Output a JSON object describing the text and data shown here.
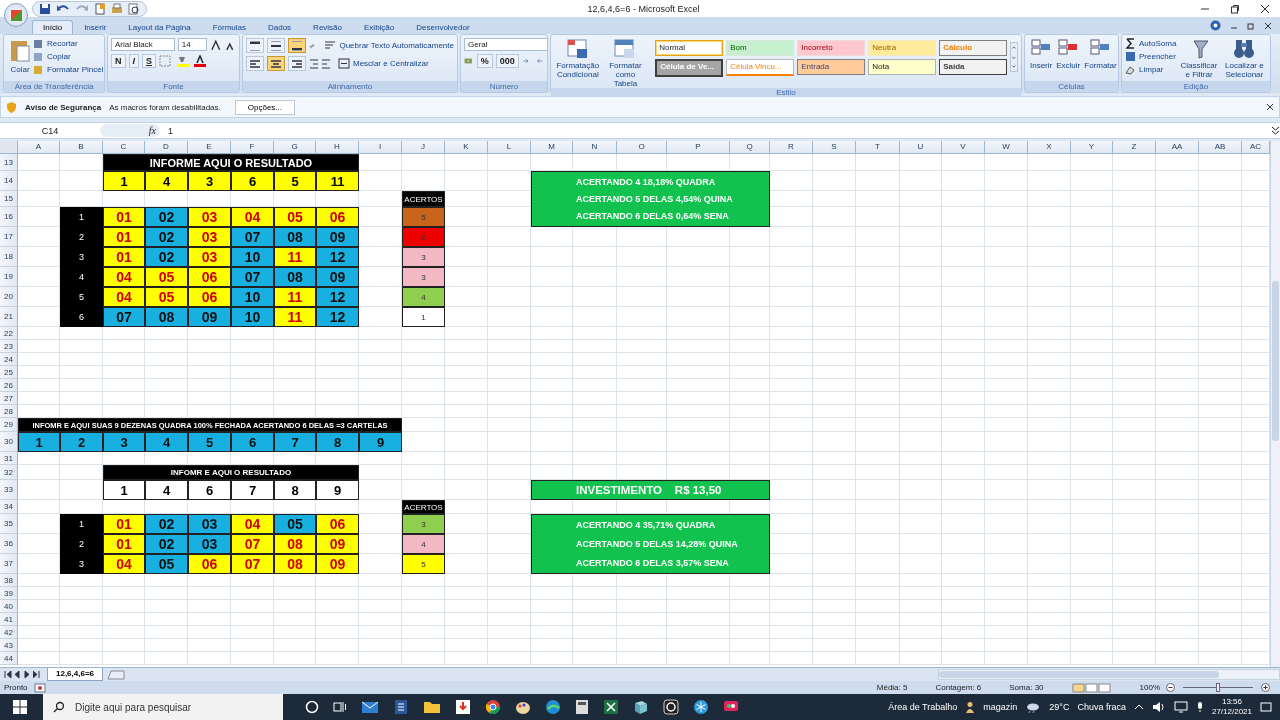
{
  "window": {
    "title": "12,6,4,6=6 - Microsoft Excel"
  },
  "tabs": [
    {
      "label": "Início",
      "selected": true
    },
    {
      "label": "Inserir",
      "selected": false
    },
    {
      "label": "Layout da Página",
      "selected": false
    },
    {
      "label": "Fórmulas",
      "selected": false
    },
    {
      "label": "Dados",
      "selected": false
    },
    {
      "label": "Revisão",
      "selected": false
    },
    {
      "label": "Exibição",
      "selected": false
    },
    {
      "label": "Desenvolvedor",
      "selected": false
    }
  ],
  "ribbon": {
    "clipboard": {
      "label": "Área de Transferência",
      "paste": "Colar",
      "items": [
        "Recortar",
        "Copiar",
        "Formatar Pincel"
      ]
    },
    "font": {
      "label": "Fonte",
      "family": "Arial Black",
      "size": "14",
      "format_buttons": [
        "N",
        "I",
        "S"
      ]
    },
    "alignment": {
      "label": "Alinhamento",
      "wrap": "Quebrar Texto Automaticamente",
      "merge": "Mesclar e Centralizar",
      "vertical": [
        {
          "selected": false
        },
        {
          "selected": false
        },
        {
          "selected": true
        }
      ],
      "horizontal": [
        {
          "selected": false
        },
        {
          "selected": true
        },
        {
          "selected": false
        }
      ]
    },
    "number": {
      "label": "Número",
      "format": "Geral",
      "buttons": [
        "%",
        "000"
      ]
    },
    "styles": {
      "label": "Estilo",
      "buttons": [
        "Formatação Condicional",
        "Formatar como Tabela"
      ],
      "gallery": [
        {
          "label": "Normal",
          "kind": "normal",
          "selected": true
        },
        {
          "label": "Bom",
          "kind": "good",
          "selected": false
        },
        {
          "label": "Incorreto",
          "kind": "bad",
          "selected": false
        },
        {
          "label": "Neutra",
          "kind": "neutral",
          "selected": false
        },
        {
          "label": "Cálculo",
          "kind": "calculation",
          "selected": false
        },
        {
          "label": "Célula de Ve...",
          "kind": "check",
          "selected": false
        },
        {
          "label": "Célula Vincu...",
          "kind": "linked",
          "selected": false
        },
        {
          "label": "Entrada",
          "kind": "input",
          "selected": false
        },
        {
          "label": "Nota",
          "kind": "note",
          "selected": false
        },
        {
          "label": "Saída",
          "kind": "output",
          "selected": false
        }
      ]
    },
    "cells": {
      "label": "Células",
      "buttons": [
        "Inserir",
        "Excluir",
        "Formatar"
      ]
    },
    "editing": {
      "label": "Edição",
      "items": [
        "AutoSoma",
        "Preencher",
        "Limpar"
      ],
      "buttons": [
        "Classificar e Filtrar",
        "Localizar e Selecionar"
      ]
    }
  },
  "security_bar": {
    "title": "Aviso de Segurança",
    "message": "As macros foram desabilitadas.",
    "button": "Opções..."
  },
  "formula_bar": {
    "name_box": "C14",
    "fx": "fx",
    "value": "1"
  },
  "sheet": {
    "columns": [
      "A",
      "B",
      "C",
      "D",
      "E",
      "F",
      "G",
      "H",
      "I",
      "J",
      "K",
      "L",
      "M",
      "N",
      "O",
      "P",
      "Q",
      "R",
      "S",
      "T",
      "U",
      "V",
      "W",
      "X",
      "Y",
      "Z",
      "AA",
      "AB",
      "AC"
    ],
    "rows": [
      "13",
      "14",
      "15",
      "16",
      "17",
      "18",
      "19",
      "20",
      "21",
      "22",
      "23",
      "24",
      "25",
      "26",
      "27",
      "28",
      "29",
      "30",
      "31",
      "32",
      "33",
      "34",
      "35",
      "36",
      "37",
      "38",
      "39",
      "40",
      "41",
      "42",
      "43",
      "44"
    ],
    "games": [
      {
        "title": "INFORME AQUI O RESULTADO",
        "result": {
          "color": "#ffff00",
          "numbers": [
            "1",
            "4",
            "3",
            "6",
            "5",
            "11"
          ]
        },
        "hits_label": "ACERTOS",
        "cards": [
          {
            "label": "1",
            "numbers": [
              {
                "text": "01",
                "hit": true
              },
              {
                "text": "02",
                "hit": false
              },
              {
                "text": "03",
                "hit": true
              },
              {
                "text": "04",
                "hit": true
              },
              {
                "text": "05",
                "hit": true
              },
              {
                "text": "06",
                "hit": true
              }
            ],
            "hits": {
              "text": "5",
              "color": "#c8651b"
            }
          },
          {
            "label": "2",
            "numbers": [
              {
                "text": "01",
                "hit": true
              },
              {
                "text": "02",
                "hit": false
              },
              {
                "text": "03",
                "hit": true
              },
              {
                "text": "07",
                "hit": false
              },
              {
                "text": "08",
                "hit": false
              },
              {
                "text": "09",
                "hit": false
              }
            ],
            "hits": {
              "text": "2",
              "color": "#ee0000"
            }
          },
          {
            "label": "3",
            "numbers": [
              {
                "text": "01",
                "hit": true
              },
              {
                "text": "02",
                "hit": false
              },
              {
                "text": "03",
                "hit": true
              },
              {
                "text": "10",
                "hit": false
              },
              {
                "text": "11",
                "hit": true
              },
              {
                "text": "12",
                "hit": false
              }
            ],
            "hits": {
              "text": "3",
              "color": "#f4b8c4"
            }
          },
          {
            "label": "4",
            "numbers": [
              {
                "text": "04",
                "hit": true
              },
              {
                "text": "05",
                "hit": true
              },
              {
                "text": "06",
                "hit": true
              },
              {
                "text": "07",
                "hit": false
              },
              {
                "text": "08",
                "hit": false
              },
              {
                "text": "09",
                "hit": false
              }
            ],
            "hits": {
              "text": "3",
              "color": "#f4b8c4"
            }
          },
          {
            "label": "5",
            "numbers": [
              {
                "text": "04",
                "hit": true
              },
              {
                "text": "05",
                "hit": true
              },
              {
                "text": "06",
                "hit": true
              },
              {
                "text": "10",
                "hit": false
              },
              {
                "text": "11",
                "hit": true
              },
              {
                "text": "12",
                "hit": false
              }
            ],
            "hits": {
              "text": "4",
              "color": "#8fce4f"
            }
          },
          {
            "label": "6",
            "numbers": [
              {
                "text": "07",
                "hit": false
              },
              {
                "text": "08",
                "hit": false
              },
              {
                "text": "09",
                "hit": false
              },
              {
                "text": "10",
                "hit": false
              },
              {
                "text": "11",
                "hit": true
              },
              {
                "text": "12",
                "hit": false
              }
            ],
            "hits": {
              "text": "1",
              "color": "#ffffff"
            }
          }
        ]
      },
      {
        "title": "INFOMR E AQUI O RESULTADO",
        "result": {
          "color": "#ffffff",
          "numbers": [
            "1",
            "4",
            "6",
            "7",
            "8",
            "9"
          ]
        },
        "hits_label": "ACERTOS",
        "cards": [
          {
            "label": "1",
            "numbers": [
              {
                "text": "01",
                "hit": true
              },
              {
                "text": "02",
                "hit": false
              },
              {
                "text": "03",
                "hit": false
              },
              {
                "text": "04",
                "hit": true
              },
              {
                "text": "05",
                "hit": false
              },
              {
                "text": "06",
                "hit": true
              }
            ],
            "hits": {
              "text": "3",
              "color": "#8fce4f"
            }
          },
          {
            "label": "2",
            "numbers": [
              {
                "text": "01",
                "hit": true
              },
              {
                "text": "02",
                "hit": false
              },
              {
                "text": "03",
                "hit": false
              },
              {
                "text": "07",
                "hit": true
              },
              {
                "text": "08",
                "hit": true
              },
              {
                "text": "09",
                "hit": true
              }
            ],
            "hits": {
              "text": "4",
              "color": "#f4b8c4"
            }
          },
          {
            "label": "3",
            "numbers": [
              {
                "text": "04",
                "hit": true
              },
              {
                "text": "05",
                "hit": false
              },
              {
                "text": "06",
                "hit": true
              },
              {
                "text": "07",
                "hit": true
              },
              {
                "text": "08",
                "hit": true
              },
              {
                "text": "09",
                "hit": true
              }
            ],
            "hits": {
              "text": "5",
              "color": "#ffff00"
            }
          }
        ]
      }
    ],
    "dezenas": {
      "title": "INFOMR E AQUI SUAS 9 DEZENAS QUADRA 100% FECHADA ACERTANDO 6 DELAS =3 CARTELAS",
      "numbers": [
        "1",
        "2",
        "3",
        "4",
        "5",
        "6",
        "7",
        "8",
        "9"
      ]
    },
    "panels": [
      {
        "kind": "odds",
        "lines": [
          "ACERTANDO 4 18,18% QUADRA",
          "ACERTANDO 5 DELAS 4,54% QUINA",
          "ACERTANDO 6 DELAS 0,64% SENA"
        ]
      },
      {
        "kind": "investment",
        "lines": [
          "INVESTIMENTO    R$ 13,50"
        ]
      },
      {
        "kind": "odds",
        "lines": [
          "ACERTANDO 4 35,71% QUADRA",
          "ACERTANDO 5 DELAS 14,28% QUINA",
          "ACERTANDO 6 DELAS 3,57% SENA"
        ]
      }
    ]
  },
  "sheet_tabs": [
    {
      "label": "12,6,4,6=6",
      "selected": true
    }
  ],
  "status_bar": {
    "state": "Pronto",
    "average": "Média: 5",
    "count": "Contagem: 6",
    "sum": "Soma: 30",
    "zoom": {
      "reading": "100%",
      "level": 0.5
    }
  },
  "taskbar": {
    "search_placeholder": "Digite aqui para pesquisar",
    "desktop": "Área de Trabalho",
    "user": "magazin",
    "temperature": "29°C",
    "weather": "Chuva fraca",
    "time": "13:56",
    "date": "27/12/2021"
  }
}
